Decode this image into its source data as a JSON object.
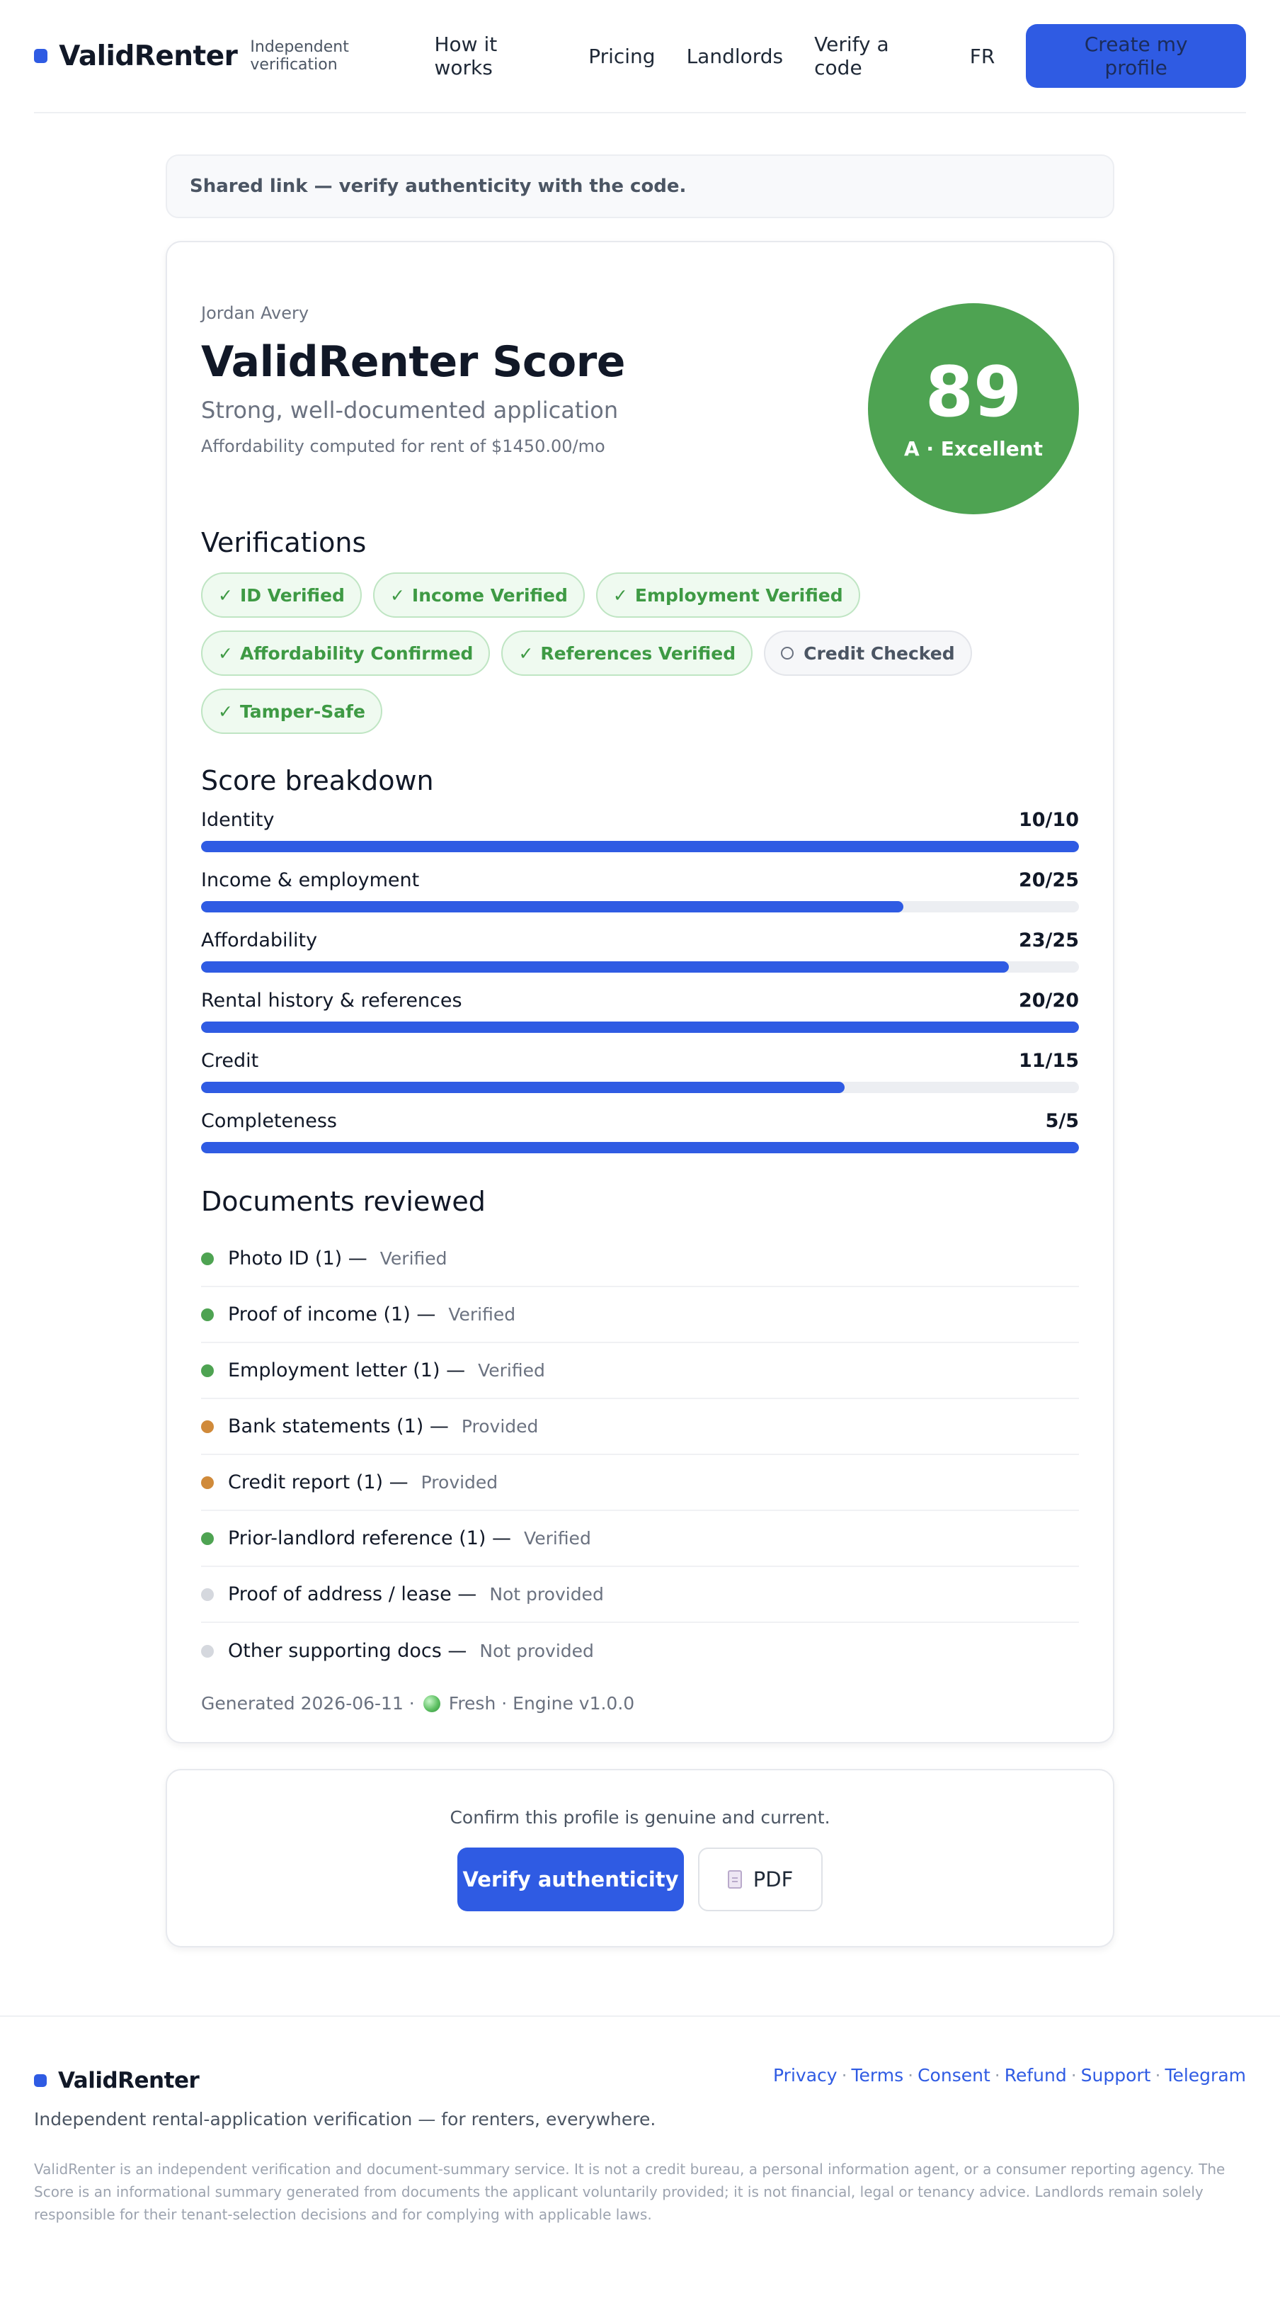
{
  "header": {
    "brand": "ValidRenter",
    "tagline": "Independent verification",
    "nav": [
      "How it works",
      "Pricing",
      "Landlords",
      "Verify a code",
      "FR"
    ],
    "cta": "Create my profile"
  },
  "notice": "Shared link — verify authenticity with the code.",
  "profile": {
    "name": "Jordan Avery",
    "title": "ValidRenter Score",
    "summary": "Strong, well-documented application",
    "affordability_note": "Affordability computed for rent of $1450.00/mo",
    "score": "89",
    "grade": "A · Excellent",
    "score_color": "#4ea352"
  },
  "verifications": {
    "title": "Verifications",
    "items": [
      {
        "label": "ID Verified",
        "status": "verified",
        "icon": "check-icon"
      },
      {
        "label": "Income Verified",
        "status": "verified",
        "icon": "check-icon"
      },
      {
        "label": "Employment Verified",
        "status": "verified",
        "icon": "check-icon"
      },
      {
        "label": "Affordability Confirmed",
        "status": "verified",
        "icon": "check-icon"
      },
      {
        "label": "References Verified",
        "status": "verified",
        "icon": "check-icon"
      },
      {
        "label": "Credit Checked",
        "status": "pending",
        "icon": "circle-icon"
      },
      {
        "label": "Tamper-Safe",
        "status": "verified",
        "icon": "check-icon"
      }
    ]
  },
  "breakdown": {
    "title": "Score breakdown",
    "items": [
      {
        "label": "Identity",
        "score": "10/10",
        "value": 10,
        "max": 10
      },
      {
        "label": "Income & employment",
        "score": "20/25",
        "value": 20,
        "max": 25
      },
      {
        "label": "Affordability",
        "score": "23/25",
        "value": 23,
        "max": 25
      },
      {
        "label": "Rental history & references",
        "score": "20/20",
        "value": 20,
        "max": 20
      },
      {
        "label": "Credit",
        "score": "11/15",
        "value": 11,
        "max": 15
      },
      {
        "label": "Completeness",
        "score": "5/5",
        "value": 5,
        "max": 5
      }
    ]
  },
  "documents": {
    "title": "Documents reviewed",
    "items": [
      {
        "name": "Photo ID (1) —",
        "status": "Verified",
        "color": "#4ea352"
      },
      {
        "name": "Proof of income (1) —",
        "status": "Verified",
        "color": "#4ea352"
      },
      {
        "name": "Employment letter (1) —",
        "status": "Verified",
        "color": "#4ea352"
      },
      {
        "name": "Bank statements (1) —",
        "status": "Provided",
        "color": "#d08a3a"
      },
      {
        "name": "Credit report (1) —",
        "status": "Provided",
        "color": "#d08a3a"
      },
      {
        "name": "Prior-landlord reference (1) —",
        "status": "Verified",
        "color": "#4ea352"
      },
      {
        "name": "Proof of address / lease —",
        "status": "Not provided",
        "color": "#d5d8de"
      },
      {
        "name": "Other supporting docs —",
        "status": "Not provided",
        "color": "#d5d8de"
      }
    ]
  },
  "generated": {
    "prefix": "Generated 2026-06-11 ·",
    "suffix": "Fresh · Engine v1.0.0"
  },
  "confirm": {
    "text": "Confirm this profile is genuine and current.",
    "verify_button": "Verify authenticity",
    "pdf_button": "PDF"
  },
  "footer": {
    "brand": "ValidRenter",
    "links": [
      "Privacy",
      "Terms",
      "Consent",
      "Refund",
      "Support",
      "Telegram"
    ],
    "tagline": "Independent rental-application verification — for renters, everywhere.",
    "disclaimer": "ValidRenter is an independent verification and document-summary service. It is not a credit bureau, a personal information agent, or a consumer reporting agency. The Score is an informational summary generated from documents the applicant voluntarily provided; it is not financial, legal or tenancy advice. Landlords remain solely responsible for their tenant-selection decisions and for complying with applicable laws."
  },
  "colors": {
    "accent": "#2f5be3",
    "verified_green": "#3e9a44",
    "provided_orange": "#d08a3a"
  }
}
